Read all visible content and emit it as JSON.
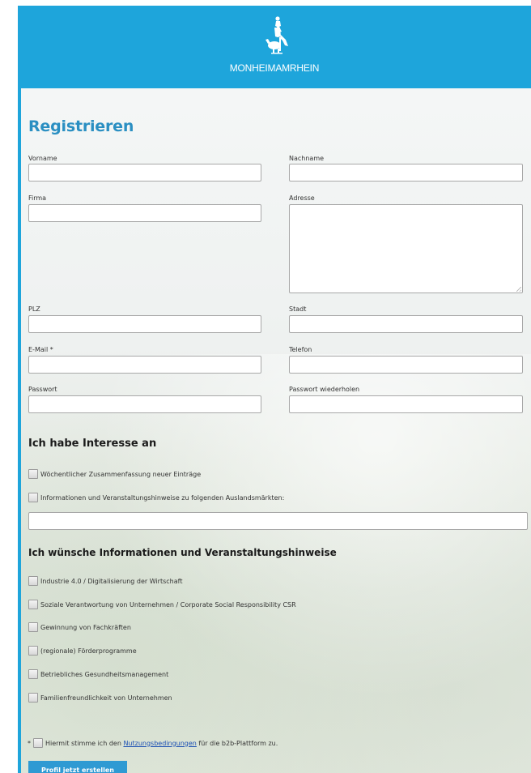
{
  "brand": {
    "logo_text": "MONHEIMAMRHEIN",
    "header_color": "#1ea5db"
  },
  "form": {
    "title": "Registrieren",
    "fields": {
      "vorname": {
        "label": "Vorname",
        "value": ""
      },
      "nachname": {
        "label": "Nachname",
        "value": ""
      },
      "firma": {
        "label": "Firma",
        "value": ""
      },
      "adresse": {
        "label": "Adresse",
        "value": ""
      },
      "plz": {
        "label": "PLZ",
        "value": ""
      },
      "stadt": {
        "label": "Stadt",
        "value": ""
      },
      "email": {
        "label": "E-Mail *",
        "value": ""
      },
      "telefon": {
        "label": "Telefon",
        "value": ""
      },
      "passwort": {
        "label": "Passwort",
        "value": ""
      },
      "passwort_wiederholen": {
        "label": "Passwort wiederholen",
        "value": ""
      }
    }
  },
  "interests": {
    "heading": "Ich habe Interesse an",
    "options": [
      {
        "label": "Wöchentlicher Zusammenfassung neuer Einträge",
        "checked": false
      },
      {
        "label": "Informationen und Veranstaltungshinweise zu folgenden Auslandsmärkten:",
        "checked": false
      }
    ],
    "markets_value": ""
  },
  "info": {
    "heading": "Ich wünsche Informationen und Veranstaltungshinweise",
    "options": [
      {
        "label": "Industrie 4.0 / Digitalisierung der Wirtschaft",
        "checked": false
      },
      {
        "label": "Soziale Verantwortung von Unternehmen / Corporate Social Responsibility CSR",
        "checked": false
      },
      {
        "label": "Gewinnung von Fachkräften",
        "checked": false
      },
      {
        "label": "(regionale) Förderprogramme",
        "checked": false
      },
      {
        "label": "Betriebliches Gesundheitsmanagement",
        "checked": false
      },
      {
        "label": "Familienfreundlichkeit von Unternehmen",
        "checked": false
      }
    ]
  },
  "terms": {
    "required_mark": "*",
    "text_before": "Hiermit stimme ich den",
    "link_text": "Nutzungsbedingungen",
    "text_after": "für die b2b-Plattform zu.",
    "checked": false
  },
  "submit_label": "Profil jetzt erstellen"
}
